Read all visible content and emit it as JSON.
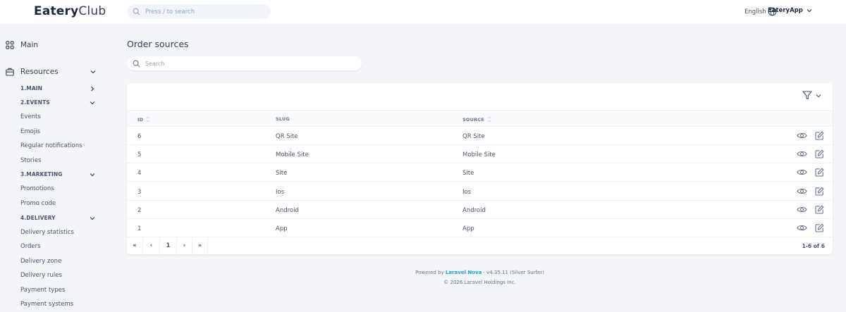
{
  "header": {
    "logo_bold": "Eatery",
    "logo_light": "Club",
    "search_placeholder": "Press / to search",
    "language": "English",
    "user": "EateryApp"
  },
  "sidebar": {
    "main": "Main",
    "resources": "Resources",
    "groups": {
      "main": "1.MAIN",
      "events": "2.EVENTS",
      "marketing": "3.MARKETING",
      "delivery": "4.DELIVERY"
    },
    "events_items": [
      "Events",
      "Emojis",
      "Regular notifications",
      "Stories"
    ],
    "marketing_items": [
      "Promotions",
      "Promo code"
    ],
    "delivery_items": [
      "Delivery statistics",
      "Orders",
      "Delivery zone",
      "Delivery rules",
      "Payment types",
      "Payment systems"
    ]
  },
  "main": {
    "title": "Order sources",
    "search_placeholder": "Search",
    "columns": [
      "ID",
      "SLUG",
      "SOURCE"
    ],
    "rows": [
      {
        "id": "6",
        "slug": "QR Site",
        "source": "QR Site"
      },
      {
        "id": "5",
        "slug": "Mobile Site",
        "source": "Mobile Site"
      },
      {
        "id": "4",
        "slug": "Site",
        "source": "Site"
      },
      {
        "id": "3",
        "slug": "Ios",
        "source": "Ios"
      },
      {
        "id": "2",
        "slug": "Android",
        "source": "Android"
      },
      {
        "id": "1",
        "slug": "App",
        "source": "App"
      }
    ],
    "pagination": {
      "first": "«",
      "prev": "‹",
      "page": "1",
      "next": "›",
      "last": "»",
      "info": "1-6 of 6"
    }
  },
  "footer": {
    "powered_prefix": "Powered by ",
    "powered_link": "Laravel Nova",
    "powered_suffix": " · v4.35.11 (Silver Surfer)",
    "copyright": "© 2026 Laravel Holdings Inc."
  },
  "colors": {
    "accent": "#0ea5e9",
    "background": "#f3f5f8",
    "card": "#ffffff"
  }
}
